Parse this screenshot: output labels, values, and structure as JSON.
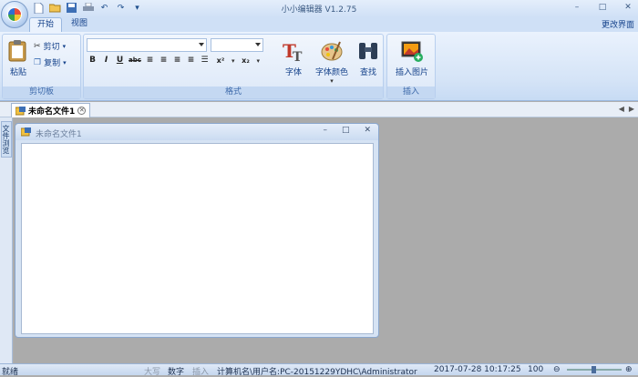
{
  "app": {
    "title": "小小编辑器 V1.2.75"
  },
  "tabs": [
    {
      "label": "开始",
      "active": true
    },
    {
      "label": "视图",
      "active": false
    }
  ],
  "ui_switch_label": "更改界面",
  "ribbon": {
    "clipboard": {
      "label": "剪切板",
      "paste_label": "粘贴",
      "cut_label": "剪切",
      "copy_label": "复制"
    },
    "format": {
      "label": "格式",
      "font_name_value": "",
      "font_size_value": "",
      "font_label": "字体",
      "font_color_label": "字体颜色",
      "find_label": "查找",
      "buttons": [
        "B",
        "I",
        "U",
        "abc",
        "≡",
        "≡",
        "≡",
        "≡",
        "☰",
        "x²",
        "x₂"
      ]
    },
    "insert": {
      "label": "插入",
      "insert_image_label": "插入图片"
    }
  },
  "document_tab": {
    "label": "未命名文件1"
  },
  "side_panel": {
    "label": "文件浏览"
  },
  "child_window": {
    "title": "未命名文件1"
  },
  "status": {
    "ready": "就绪",
    "caps": "大写",
    "num": "数字",
    "insert": "插入",
    "machine_user": "计算机名\\用户名:PC-20151229YDHC\\Administrator",
    "datetime": "2017-07-28 10:17:25",
    "zoom": "100"
  },
  "icons": {
    "app_menu": "app-menu-orb-icon",
    "qat": [
      "new-file-icon",
      "open-folder-icon",
      "save-icon",
      "print-icon",
      "undo-icon",
      "redo-icon"
    ]
  },
  "colors": {
    "ribbon_bg": "#dce8f8",
    "workspace": "#ababab",
    "accent": "#15428b"
  }
}
